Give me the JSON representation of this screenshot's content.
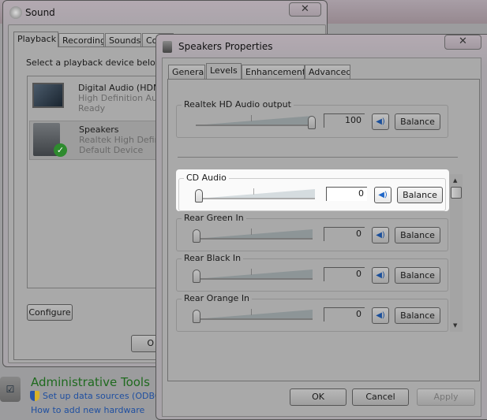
{
  "sound_window": {
    "title": "Sound",
    "close_glyph": "✕",
    "tabs": [
      {
        "label": "Playback"
      },
      {
        "label": "Recording"
      },
      {
        "label": "Sounds"
      },
      {
        "label": "Co"
      }
    ],
    "instruction": "Select a playback device below t",
    "devices": [
      {
        "name": "Digital Audio (HDM",
        "desc": "High Definition Aud",
        "status": "Ready",
        "icon": "monitor-icon"
      },
      {
        "name": "Speakers",
        "desc": "Realtek High Defini",
        "status": "Default Device",
        "icon": "speaker-icon",
        "selected": true,
        "default_badge": "green-check-icon"
      }
    ],
    "configure_label": "Configure",
    "ok_label": "O"
  },
  "control_panel": {
    "heading": "Administrative Tools",
    "links": [
      {
        "label": "Set up data sources (ODBC)",
        "icon": "uac-shield-icon"
      },
      {
        "label": "How to add new hardware"
      }
    ]
  },
  "properties": {
    "title": "Speakers Properties",
    "close_glyph": "✕",
    "tabs": [
      {
        "label": "General"
      },
      {
        "label": "Levels",
        "active": true
      },
      {
        "label": "Enhancements"
      },
      {
        "label": "Advanced"
      }
    ],
    "balance_label": "Balance",
    "master": {
      "label": "Realtek HD Audio output",
      "value": "100",
      "level": 100
    },
    "inputs": [
      {
        "label": "CD Audio",
        "value": "0",
        "level": 0,
        "highlighted": true
      },
      {
        "label": "Rear Green In",
        "value": "0",
        "level": 0
      },
      {
        "label": "Rear Black In",
        "value": "0",
        "level": 0
      },
      {
        "label": "Rear Orange In",
        "value": "0",
        "level": 0
      }
    ],
    "buttons": {
      "ok": "OK",
      "cancel": "Cancel",
      "apply": "Apply"
    }
  },
  "colors": {
    "highlight": "#fafafa",
    "link": "#1f4fa0",
    "heading": "#1f6a1f",
    "mute_icon": "#1e66c8"
  }
}
